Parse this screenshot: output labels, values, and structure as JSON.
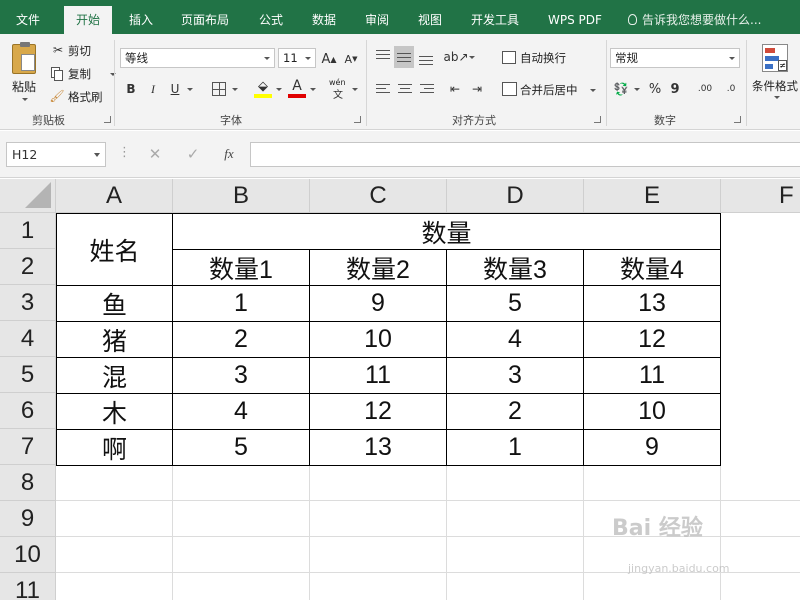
{
  "menu": {
    "tabs": [
      {
        "label": "文件"
      },
      {
        "label": "开始"
      },
      {
        "label": "插入"
      },
      {
        "label": "页面布局"
      },
      {
        "label": "公式"
      },
      {
        "label": "数据"
      },
      {
        "label": "审阅"
      },
      {
        "label": "视图"
      },
      {
        "label": "开发工具"
      },
      {
        "label": "WPS PDF"
      }
    ],
    "active_tab": "开始",
    "tell_me": "告诉我您想要做什么..."
  },
  "ribbon": {
    "clipboard": {
      "paste": "粘贴",
      "cut": "剪切",
      "copy": "复制",
      "format_painter": "格式刷",
      "label": "剪贴板"
    },
    "font": {
      "font_name": "等线",
      "font_size": "11",
      "grow": "A",
      "shrink": "A",
      "bold": "B",
      "italic": "I",
      "underline": "U",
      "phonetic": "wén",
      "font_color_glyph": "A",
      "label": "字体"
    },
    "alignment": {
      "wrap_text": "自动换行",
      "merge_center": "合并后居中",
      "label": "对齐方式"
    },
    "number": {
      "format": "常规",
      "percent": "%",
      "comma": "9",
      "inc_decimal": ".00",
      "dec_decimal": ".0",
      "label": "数字"
    },
    "styles": {
      "conditional_format": "条件格式"
    },
    "colors": {
      "fill_highlight": "#ffff00",
      "font_red": "#e00000"
    }
  },
  "formula_bar": {
    "name_box": "H12",
    "fx": "fx",
    "formula": ""
  },
  "sheet": {
    "columns": [
      "A",
      "B",
      "C",
      "D",
      "E",
      "F"
    ],
    "rows": [
      "1",
      "2",
      "3",
      "4",
      "5",
      "6",
      "7",
      "8",
      "9",
      "10",
      "11"
    ],
    "header_merged_name": "姓名",
    "header_merged_group": "数量",
    "subheaders": [
      "数量1",
      "数量2",
      "数量3",
      "数量4"
    ],
    "data": [
      {
        "name": "鱼",
        "values": [
          "1",
          "9",
          "5",
          "13"
        ]
      },
      {
        "name": "猪",
        "values": [
          "2",
          "10",
          "4",
          "12"
        ]
      },
      {
        "name": "混",
        "values": [
          "3",
          "11",
          "3",
          "11"
        ]
      },
      {
        "name": "木",
        "values": [
          "4",
          "12",
          "2",
          "10"
        ]
      },
      {
        "name": "啊",
        "values": [
          "5",
          "13",
          "1",
          "9"
        ]
      }
    ]
  },
  "watermark": {
    "text": "Bai 经验",
    "sub": "jingyan.baidu.com"
  },
  "theme": {
    "accent": "#217346"
  }
}
